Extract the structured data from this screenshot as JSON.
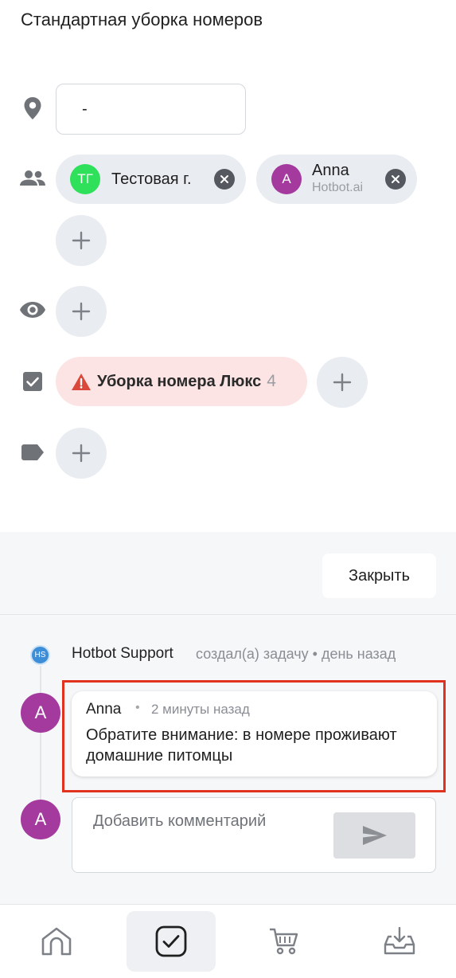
{
  "task": {
    "title": "Стандартная уборка номеров"
  },
  "location": {
    "value": "-"
  },
  "assignees": [
    {
      "initials": "ТГ",
      "name": "Тестовая г.",
      "subtitle": "",
      "avatar_color": "#2ee05a"
    },
    {
      "initials": "A",
      "name": "Anna",
      "subtitle": "Hotbot.ai",
      "avatar_color": "#a43a9e"
    }
  ],
  "checklist": {
    "label": "Уборка номера Люкс",
    "count": "4",
    "chip_color": "#fde4e4",
    "warning_color": "#d9483b"
  },
  "actions": {
    "close_label": "Закрыть"
  },
  "activity": {
    "log_badge": "HS",
    "log_author": "Hotbot Support",
    "log_action": "создал(а) задачу • день назад"
  },
  "comment": {
    "avatar": "A",
    "author": "Anna",
    "separator": "•",
    "time": "2 минуты назад",
    "text": "Обратите внимание: в номере проживают домашние питомцы"
  },
  "new_comment": {
    "avatar": "A",
    "placeholder": "Добавить комментарий"
  },
  "nav": {
    "items": [
      {
        "icon": "home-icon",
        "active": false
      },
      {
        "icon": "tasks-check-icon",
        "active": true
      },
      {
        "icon": "cart-icon",
        "active": false
      },
      {
        "icon": "inbox-download-icon",
        "active": false
      }
    ]
  },
  "colors": {
    "accent_purple": "#a43a9e",
    "highlight_red": "#e0321e",
    "badge_blue": "#3d8ed9"
  }
}
